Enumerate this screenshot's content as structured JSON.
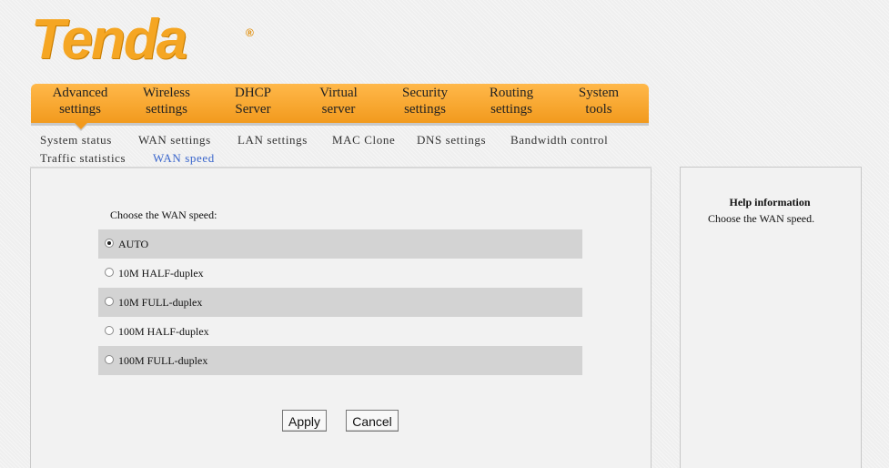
{
  "brand": {
    "logo_text": "Tenda",
    "logo_mark": "®",
    "color": "#f5a623"
  },
  "menu": [
    {
      "line1": "Advanced",
      "line2": "settings"
    },
    {
      "line1": "Wireless",
      "line2": "settings"
    },
    {
      "line1": "DHCP",
      "line2": "Server"
    },
    {
      "line1": "Virtual",
      "line2": "server"
    },
    {
      "line1": "Security",
      "line2": "settings"
    },
    {
      "line1": "Routing",
      "line2": "settings"
    },
    {
      "line1": "System",
      "line2": "tools"
    }
  ],
  "submenu": [
    {
      "label": "System status"
    },
    {
      "label": "WAN settings"
    },
    {
      "label": "LAN settings"
    },
    {
      "label": "MAC Clone"
    },
    {
      "label": "DNS settings"
    },
    {
      "label": "Bandwidth control"
    },
    {
      "label": "Traffic statistics"
    },
    {
      "label": "WAN speed",
      "active": true
    }
  ],
  "form": {
    "choose_label": "Choose the WAN speed:",
    "options": [
      {
        "label": "AUTO",
        "checked": true
      },
      {
        "label": "10M HALF-duplex",
        "checked": false
      },
      {
        "label": "10M FULL-duplex",
        "checked": false
      },
      {
        "label": "100M HALF-duplex",
        "checked": false
      },
      {
        "label": "100M FULL-duplex",
        "checked": false
      }
    ],
    "apply_label": "Apply",
    "cancel_label": "Cancel"
  },
  "help": {
    "title": "Help information",
    "text": "Choose the WAN speed."
  }
}
